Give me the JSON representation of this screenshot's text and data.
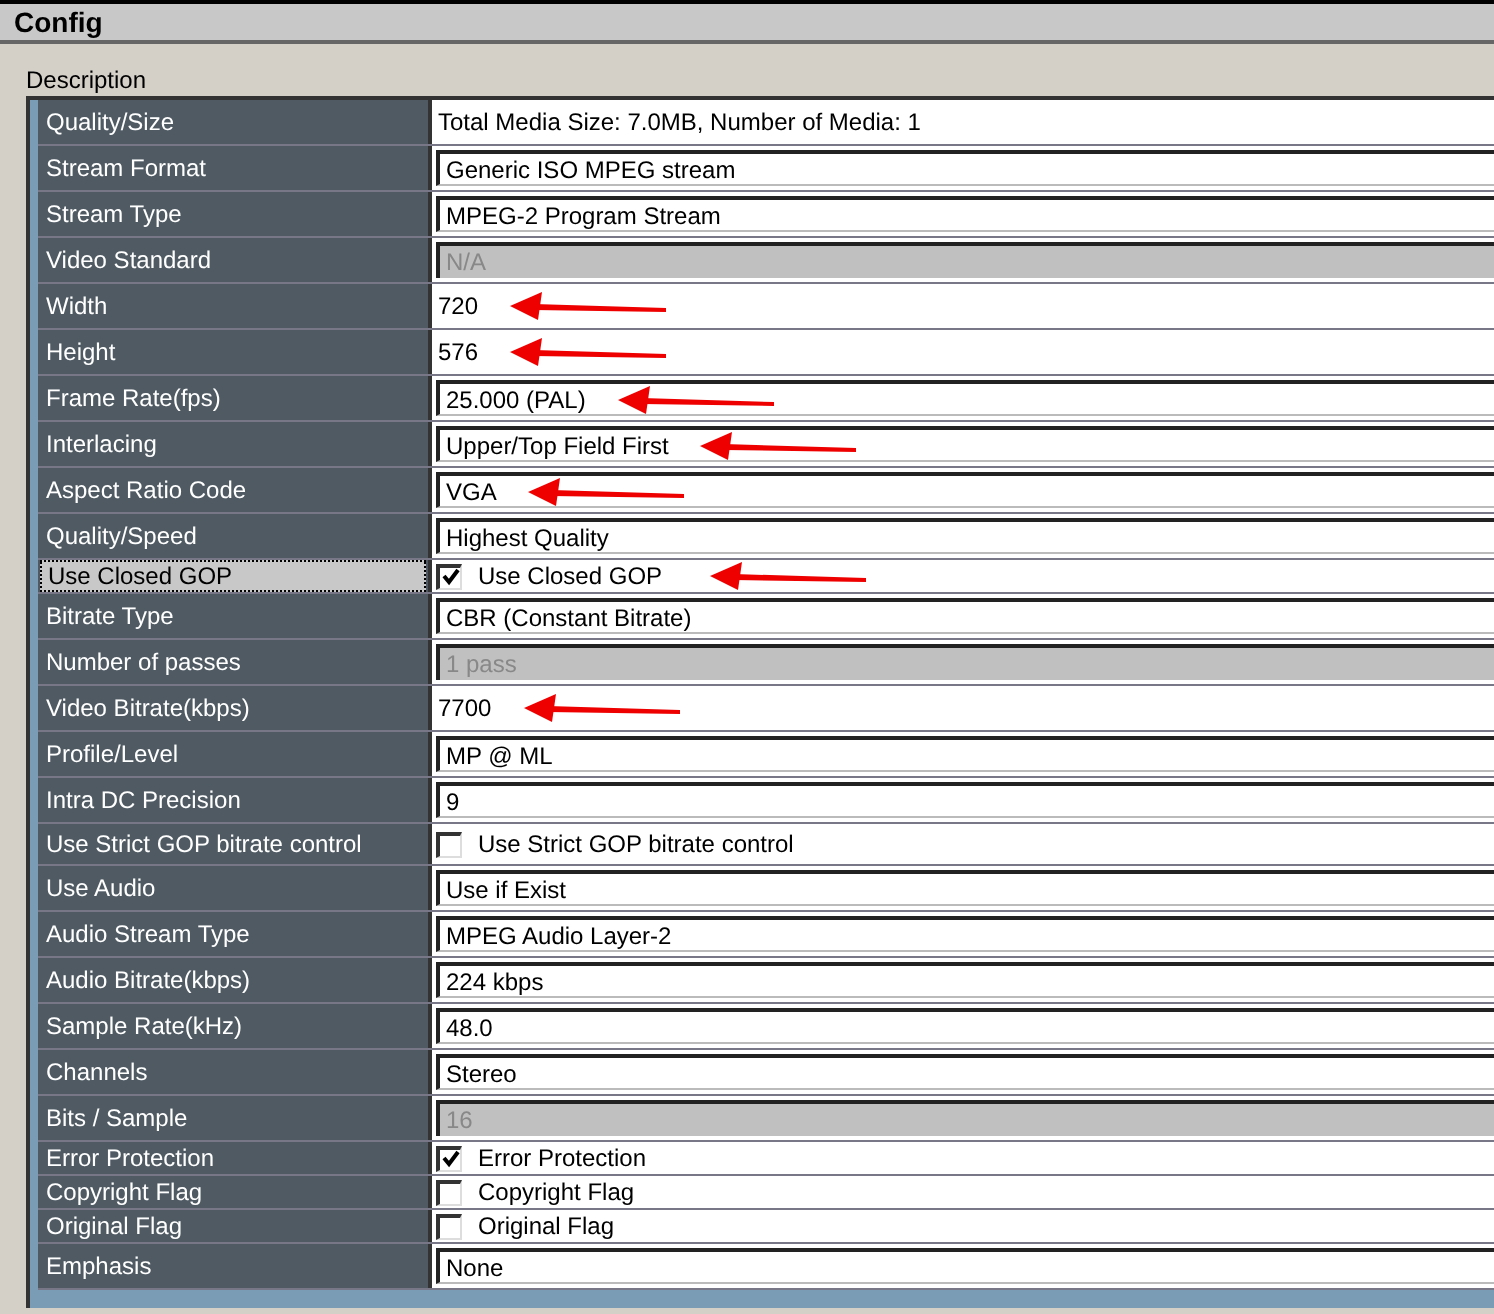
{
  "window": {
    "title": "Config"
  },
  "group": {
    "label": "Description"
  },
  "rows": [
    {
      "label": "Quality/Size",
      "kind": "static",
      "value": "Total Media Size: 7.0MB, Number of Media: 1",
      "selected": false,
      "annotated": false
    },
    {
      "label": "Stream Format",
      "kind": "field",
      "value": "Generic ISO MPEG stream",
      "selected": false,
      "annotated": false
    },
    {
      "label": "Stream Type",
      "kind": "field",
      "value": "MPEG-2 Program Stream",
      "selected": false,
      "annotated": false
    },
    {
      "label": "Video Standard",
      "kind": "disabled",
      "value": "N/A",
      "selected": false,
      "annotated": false
    },
    {
      "label": "Width",
      "kind": "static",
      "value": "720",
      "selected": false,
      "annotated": true
    },
    {
      "label": "Height",
      "kind": "static",
      "value": "576",
      "selected": false,
      "annotated": true
    },
    {
      "label": "Frame Rate(fps)",
      "kind": "field",
      "value": "25.000 (PAL)",
      "selected": false,
      "annotated": true
    },
    {
      "label": "Interlacing",
      "kind": "field",
      "value": "Upper/Top Field First",
      "selected": false,
      "annotated": true
    },
    {
      "label": "Aspect Ratio Code",
      "kind": "field",
      "value": "VGA",
      "selected": false,
      "annotated": true
    },
    {
      "label": "Quality/Speed",
      "kind": "field",
      "value": "Highest Quality",
      "selected": false,
      "annotated": false
    },
    {
      "label": "Use Closed GOP",
      "kind": "checkbox",
      "value": "Use Closed GOP",
      "checked": true,
      "selected": true,
      "annotated": true
    },
    {
      "label": "Bitrate Type",
      "kind": "field",
      "value": "CBR (Constant Bitrate)",
      "selected": false,
      "annotated": false
    },
    {
      "label": "Number of passes",
      "kind": "disabled",
      "value": "1 pass",
      "selected": false,
      "annotated": false
    },
    {
      "label": "Video Bitrate(kbps)",
      "kind": "static",
      "value": "7700",
      "selected": false,
      "annotated": true
    },
    {
      "label": "Profile/Level",
      "kind": "field",
      "value": "MP @ ML",
      "selected": false,
      "annotated": false
    },
    {
      "label": "Intra DC Precision",
      "kind": "field",
      "value": "9",
      "selected": false,
      "annotated": false
    },
    {
      "label": "Use Strict GOP bitrate control",
      "kind": "checkbox",
      "value": "Use Strict GOP bitrate control",
      "checked": false,
      "selected": false,
      "annotated": false
    },
    {
      "label": "Use Audio",
      "kind": "field",
      "value": "Use if Exist",
      "selected": false,
      "annotated": false
    },
    {
      "label": "Audio Stream Type",
      "kind": "field",
      "value": "MPEG Audio Layer-2",
      "selected": false,
      "annotated": false
    },
    {
      "label": "Audio Bitrate(kbps)",
      "kind": "field",
      "value": "224 kbps",
      "selected": false,
      "annotated": false
    },
    {
      "label": "Sample Rate(kHz)",
      "kind": "field",
      "value": "48.0",
      "selected": false,
      "annotated": false
    },
    {
      "label": "Channels",
      "kind": "field",
      "value": "Stereo",
      "selected": false,
      "annotated": false
    },
    {
      "label": "Bits / Sample",
      "kind": "disabled",
      "value": "16",
      "selected": false,
      "annotated": false
    },
    {
      "label": "Error Protection",
      "kind": "checkbox",
      "value": "Error Protection",
      "checked": true,
      "selected": false,
      "annotated": false
    },
    {
      "label": "Copyright Flag",
      "kind": "checkbox",
      "value": "Copyright Flag",
      "checked": false,
      "selected": false,
      "annotated": false
    },
    {
      "label": "Original Flag",
      "kind": "checkbox",
      "value": "Original Flag",
      "checked": false,
      "selected": false,
      "annotated": false
    },
    {
      "label": "Emphasis",
      "kind": "field",
      "value": "None",
      "selected": false,
      "annotated": false
    }
  ]
}
